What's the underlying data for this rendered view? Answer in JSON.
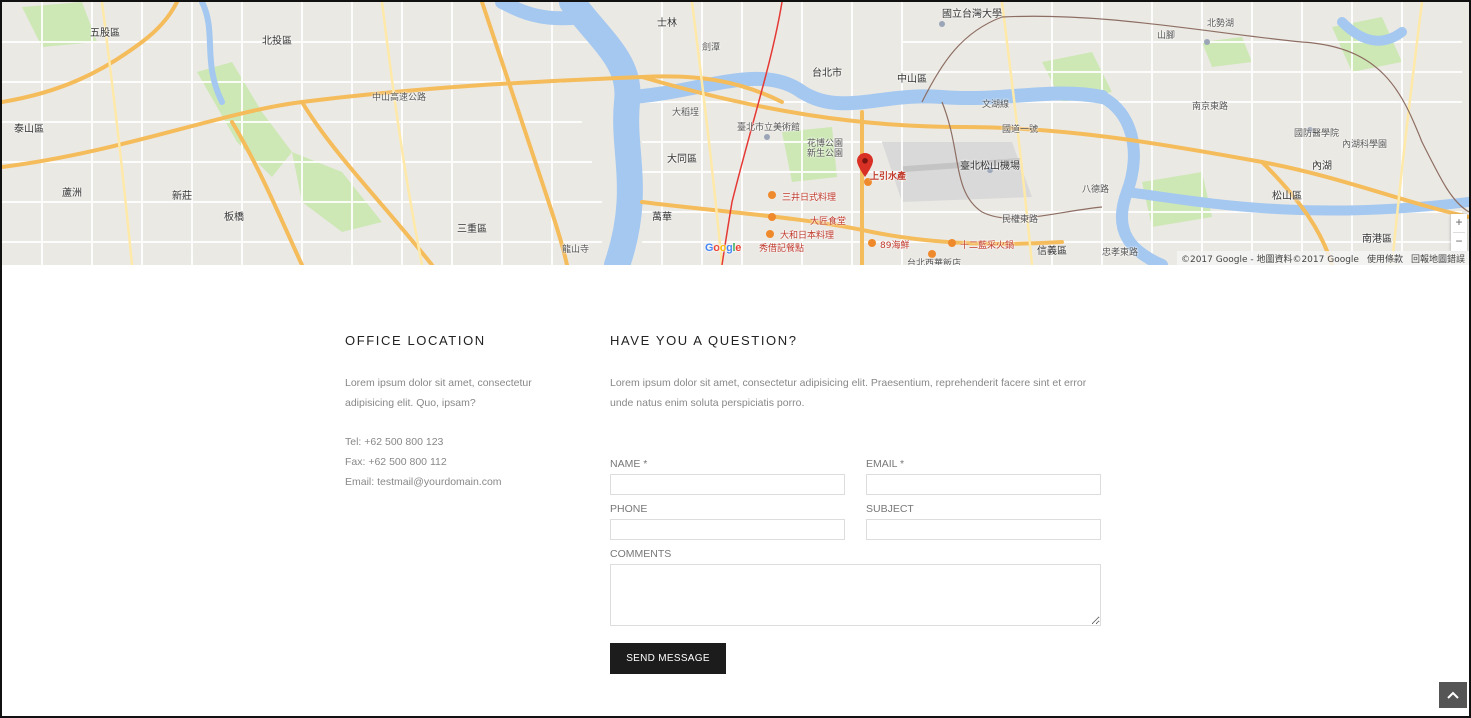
{
  "map": {
    "attribution": {
      "copyright": "©2017 Google - 地圖資料©2017 Google",
      "terms": "使用條款",
      "report": "回報地圖錯誤"
    },
    "google_logo": "Google",
    "zoom_in": "+",
    "zoom_out": "−",
    "marker_label": "上引水產",
    "labels": [
      "五股區",
      "蘆洲",
      "三重區",
      "新莊",
      "泰山區",
      "板橋",
      "台北市",
      "中山區",
      "內湖",
      "北投區",
      "士林",
      "大同區",
      "萬華",
      "信義區",
      "松山區",
      "南港區",
      "臺北松山機場",
      "國立台灣大學",
      "中山高速公路",
      "國道一號",
      "民權東路",
      "南京東路",
      "八德路",
      "忠孝東路",
      "龍山寺",
      "花博公園",
      "新生公園",
      "臺北市立美術館",
      "大稻埕",
      "劍潭",
      "文湖線",
      "三井日式料理",
      "大和日本料理",
      "大匠食堂",
      "秀借記餐點",
      "89海鮮",
      "十二藍采火鍋",
      "台北西華飯店",
      "國防醫學院",
      "內湖科學園",
      "北勢湖",
      "山腳"
    ]
  },
  "office": {
    "heading": "OFFICE LOCATION",
    "description": "Lorem ipsum dolor sit amet, consectetur adipisicing elit. Quo, ipsam?",
    "tel": "Tel: +62 500 800 123",
    "fax": "Fax: +62 500 800 112",
    "email": "Email: testmail@yourdomain.com"
  },
  "question": {
    "heading": "HAVE YOU A QUESTION?",
    "description": "Lorem ipsum dolor sit amet, consectetur adipisicing elit. Praesentium, reprehenderit facere sint et error unde natus enim soluta perspiciatis porro."
  },
  "form": {
    "name_label": "NAME *",
    "name_value": "",
    "email_label": "EMAIL *",
    "email_value": "",
    "phone_label": "PHONE",
    "phone_value": "",
    "subject_label": "SUBJECT",
    "subject_value": "",
    "comments_label": "COMMENTS",
    "comments_value": "",
    "send_label": "SEND MESSAGE"
  },
  "icons": {
    "back_to_top": "chevron-up-icon",
    "marker": "map-pin-icon"
  },
  "colors": {
    "button_bg": "#1c1c1c",
    "heading": "#222222",
    "text": "#888888",
    "marker": "#d93025",
    "water": "#a4c8f0",
    "highway": "#f5bc5c"
  }
}
